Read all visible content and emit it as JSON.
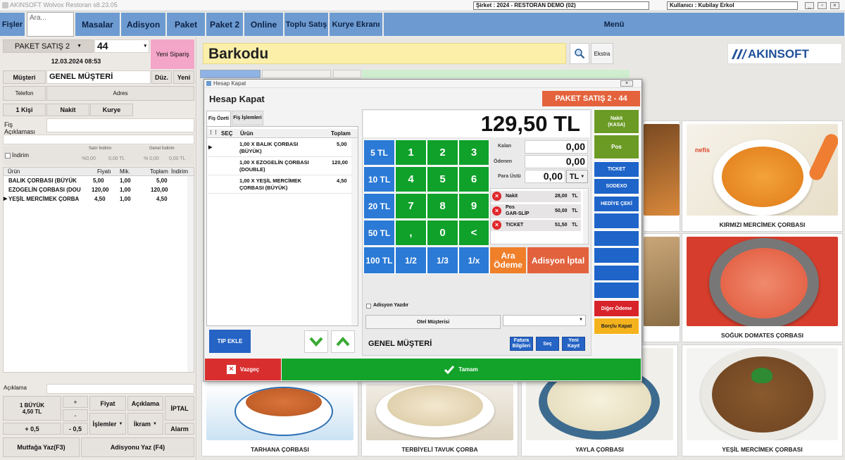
{
  "title_bar": {
    "app": "AKINSOFT Wolvox Restoran s8.23.05",
    "company": "Şirket : 2024 - RESTORAN DEMO (02)",
    "user": "Kullanıcı : Kubilay Erkol"
  },
  "nav": {
    "fisler": "Fişler",
    "search_placeholder": "Ara...",
    "masalar": "Masalar",
    "adisyon": "Adisyon",
    "paket": "Paket",
    "paket2": "Paket 2",
    "online": "Online",
    "toplu": "Toplu Satış",
    "kurye": "Kurye Ekranı",
    "menu": "Menü"
  },
  "order": {
    "type": "PAKET SATIŞ 2",
    "number": "44",
    "date": "12.03.2024 08:53",
    "new_order": "Yeni Sipariş"
  },
  "customer": {
    "label": "Müşteri",
    "name": "GENEL MÜŞTERİ",
    "edit": "Düz.",
    "new": "Yeni",
    "phone": "Telefon",
    "address": "Adres",
    "persons": "1 Kişi",
    "payment": "Nakit",
    "courier": "Kurye",
    "note_label": "Fiş Açıklaması"
  },
  "discount": {
    "label": "İndirim",
    "row_discount": "Satır İndirim",
    "general_discount": "Genel İndirim",
    "v1": "%0,00",
    "v2": "0,00 TL",
    "v3": "% 0,00",
    "v4": "0,00 TL"
  },
  "items_table": {
    "headers": [
      "Ürün",
      "Fiyatı",
      "Mik.",
      "Toplam",
      "İndirim"
    ],
    "rows": [
      {
        "name": "BALIK ÇORBASI (BÜYÜK",
        "price": "5,00",
        "qty": "1,00",
        "total": "5,00"
      },
      {
        "name": "EZOGELİN ÇORBASI (DOU",
        "price": "120,00",
        "qty": "1,00",
        "total": "120,00"
      },
      {
        "name": "YEŞİL MERCİMEK ÇORBA",
        "price": "4,50",
        "qty": "1,00",
        "total": "4,50"
      }
    ]
  },
  "bottom_left": {
    "aciklama": "Açıklama",
    "selected_line1": "1 BÜYÜK",
    "selected_line2": "4,50 TL",
    "plus": "+",
    "minus": "-",
    "plus05": "+ 0,5",
    "minus05": "- 0,5",
    "fiyat": "Fiyat",
    "aciklama_btn": "Açıklama",
    "islemler": "İşlemler",
    "ikram": "İkram",
    "iptal": "İPTAL",
    "alarm": "Alarm",
    "mutfaga": "Mutfağa Yaz(F3)",
    "adisyonu": "Adisyonu Yaz (F4)"
  },
  "barcode": {
    "label": "Barkodu",
    "ekstra": "Ekstra",
    "logo": "AKINSOFT"
  },
  "products": [
    {
      "name": "KIRMIZI MERCİMEK ÇORBASI"
    },
    {
      "name": "SOĞUK DOMATES ÇORBASI"
    },
    {
      "name": "TARHANA ÇORBASI"
    },
    {
      "name": "TERBİYELİ TAVUK ÇORBA"
    },
    {
      "name": "YAYLA ÇORBASI"
    },
    {
      "name": "YEŞİL MERCİMEK ÇORBASI"
    }
  ],
  "product_badge": "nefis",
  "dialog": {
    "window_title": "Hesap Kapat",
    "heading": "Hesap Kapat",
    "order_badge": "PAKET SATIŞ 2 - 44",
    "tabs": [
      "Fiş Özeti",
      "Fiş İşlemleri"
    ],
    "list_headers": [
      "SEÇ",
      "Ürün",
      "Toplam"
    ],
    "list_rows": [
      {
        "l1": "1,00 X BALIK ÇORBASI",
        "l2": "(BÜYÜK)",
        "total": "5,00"
      },
      {
        "l1": "1,00 X EZOGELİN ÇORBASI",
        "l2": "(DOUBLE)",
        "total": "120,00"
      },
      {
        "l1": "1,00 X YEŞİL MERCİMEK",
        "l2": "ÇORBASI (BÜYÜK)",
        "total": "4,50"
      }
    ],
    "tip": "TIP EKLE",
    "total": "129,50 TL",
    "quick": [
      "5 TL",
      "10 TL",
      "20 TL",
      "50 TL",
      "100 TL"
    ],
    "keys": [
      "1",
      "2",
      "3",
      "4",
      "5",
      "6",
      "7",
      "8",
      "9",
      ",",
      "0",
      "<"
    ],
    "fractions": [
      "1/2",
      "1/3",
      "1/x"
    ],
    "ara_odeme": "Ara Ödeme",
    "adisyon_iptal": "Adisyon İptal",
    "kalan_label": "Kalan",
    "kalan": "0,00",
    "odenen_label": "Ödenen",
    "odenen": "0,00",
    "para_ustu_label": "Para Üstü",
    "para_ustu": "0,00",
    "currency": "TL",
    "payments": [
      {
        "name": "Nakit",
        "sub": "",
        "amount": "28,00",
        "cur": "TL"
      },
      {
        "name": "Pos",
        "sub": "GAR-SLİP",
        "amount": "50,00",
        "cur": "TL"
      },
      {
        "name": "TICKET",
        "sub": "",
        "amount": "51,50",
        "cur": "TL"
      }
    ],
    "side": [
      "Nakit\n(KASA)",
      "Pos",
      "TICKET",
      "SODEXO",
      "HEDİYE ÇEKİ",
      "",
      "",
      "",
      "",
      "",
      "Diğer Ödeme",
      "Borçlu Kapat"
    ],
    "adisyon_yazdir": "Adisyon Yazdır",
    "otel": "Otel Müşterisi",
    "customer": "GENEL MÜŞTERİ",
    "fatura": "Fatura Bilgileri",
    "sec": "Seç",
    "yeni": "Yeni Kayıt",
    "vazgec": "Vazgeç",
    "tamam": "Tamam"
  },
  "colors": {
    "nav": "#6d9bd1",
    "green": "#0fa12a",
    "blue": "#2b7ad6",
    "orange": "#f07f2a",
    "salmon": "#e2623e"
  }
}
